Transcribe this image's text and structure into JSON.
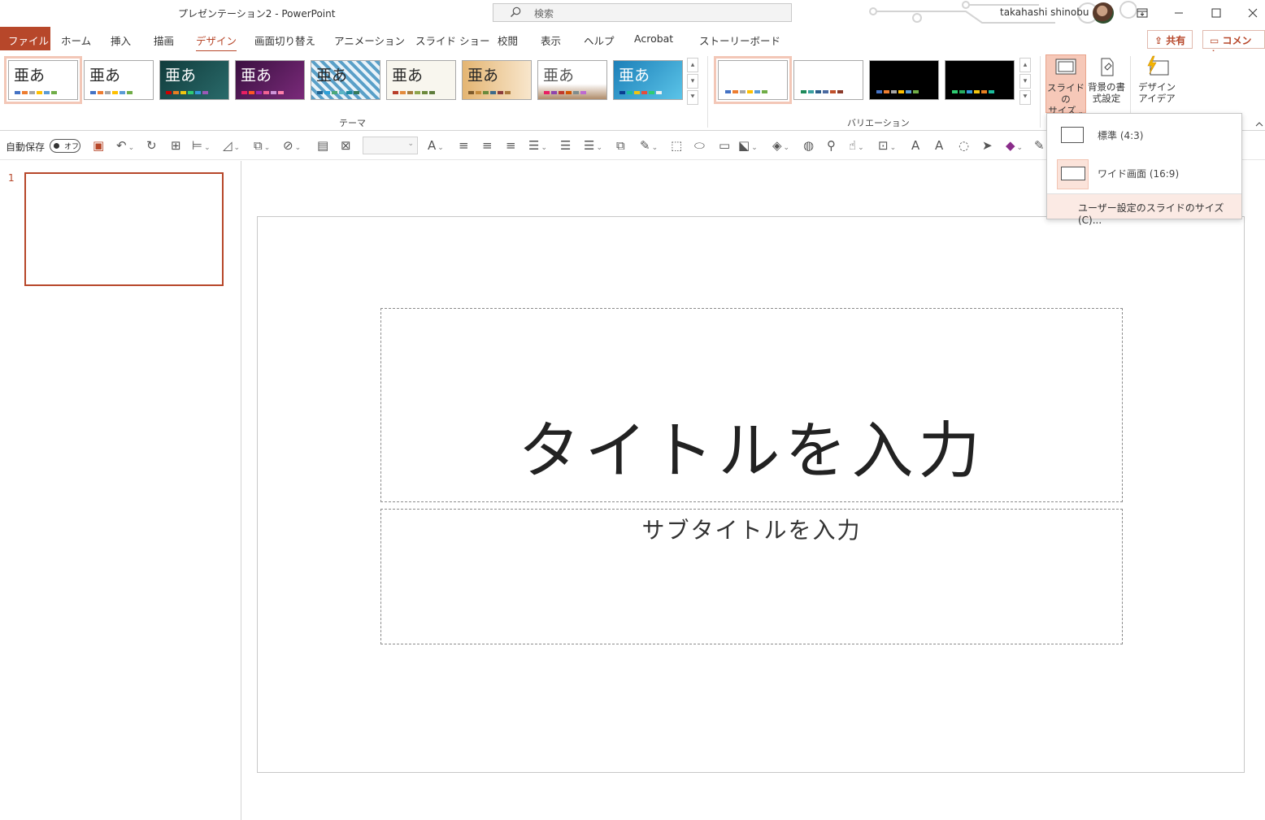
{
  "window": {
    "title": "プレゼンテーション2  -  PowerPoint",
    "search_placeholder": "検索",
    "user_name": "takahashi shinobu"
  },
  "tabs": {
    "file": "ファイル",
    "items": [
      "ホーム",
      "挿入",
      "描画",
      "デザイン",
      "画面切り替え",
      "アニメーション",
      "スライド ショー",
      "校閲",
      "表示",
      "ヘルプ",
      "Acrobat",
      "ストーリーボード"
    ],
    "active": "デザイン",
    "share": "共有",
    "comment": "コメント"
  },
  "ribbon": {
    "themes_label": "テーマ",
    "variations_label": "バリエーション",
    "theme_sample": "亜あ",
    "slide_size_line1": "スライドの",
    "slide_size_line2": "サイズ",
    "format_bg_line1": "背景の書",
    "format_bg_line2": "式設定",
    "design_ideas_line1": "デザイン",
    "design_ideas_line2": "アイデア"
  },
  "qat": {
    "autosave": "自動保存",
    "toggle": "オフ"
  },
  "thumbnails": {
    "slide_number": "1"
  },
  "slide": {
    "title_placeholder": "タイトルを入力",
    "subtitle_placeholder": "サブタイトルを入力"
  },
  "slide_size_menu": {
    "standard": "標準 (4:3)",
    "widescreen": "ワイド画面 (16:9)",
    "custom": "ユーザー設定のスライドのサイズ(C)..."
  },
  "colors": {
    "accent": "#b7472a",
    "selection_bg": "#fbe3da"
  }
}
